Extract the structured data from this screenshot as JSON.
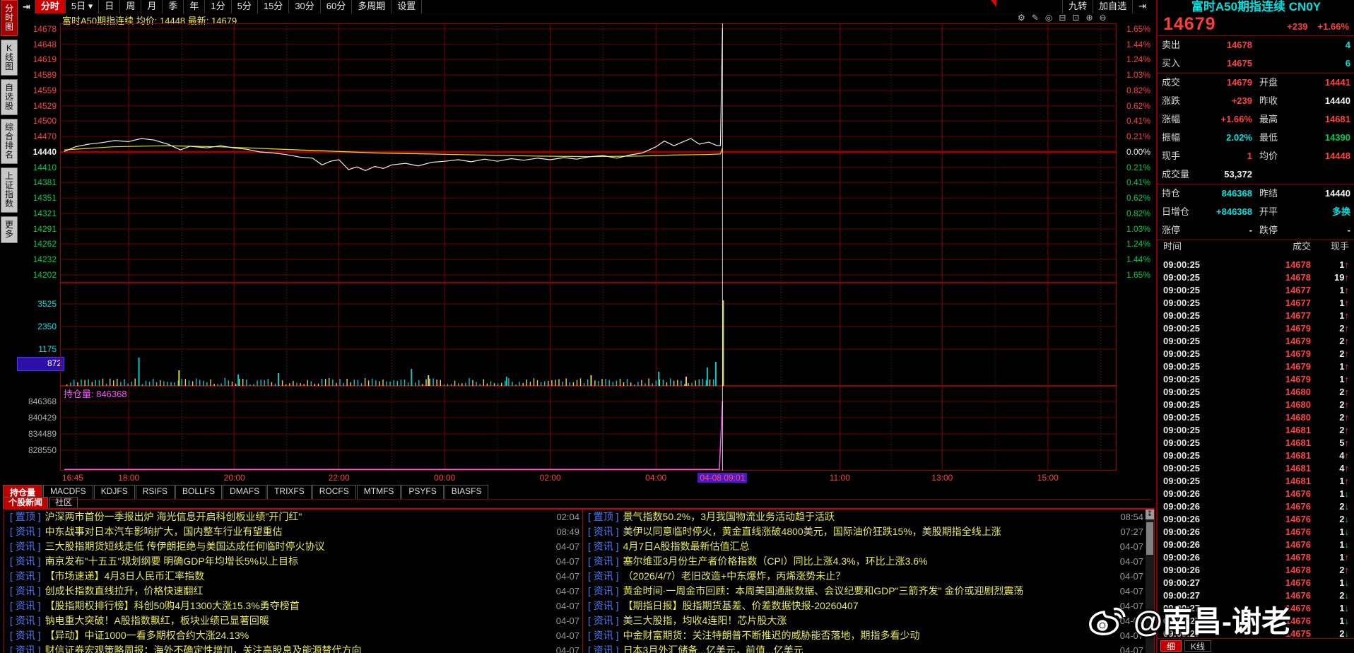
{
  "toolbar": {
    "jump_icon": "⇥",
    "items": [
      {
        "label": "分时",
        "selected": true
      },
      {
        "label": "5日",
        "caret": "▾"
      },
      {
        "label": "日"
      },
      {
        "label": "周"
      },
      {
        "label": "月"
      },
      {
        "label": "季"
      },
      {
        "label": "年"
      },
      {
        "label": "1分"
      },
      {
        "label": "5分"
      },
      {
        "label": "15分"
      },
      {
        "label": "30分"
      },
      {
        "label": "60分"
      },
      {
        "label": "多周期"
      },
      {
        "label": "设置"
      }
    ],
    "right_items": [
      "九转",
      "加自选"
    ],
    "right_jump_icon": "⇥"
  },
  "sidebar": {
    "items": [
      {
        "label": "分时图",
        "selected": true
      },
      {
        "label": "K线图"
      },
      {
        "label": "自选股"
      },
      {
        "label": "综合排名"
      },
      {
        "label": "上证指数"
      },
      {
        "label": "更多"
      }
    ]
  },
  "chart": {
    "header": {
      "name": "富时A50期指连续",
      "avg_label": "均价:",
      "avg": "14448",
      "last_label": "最新:",
      "last": "14679"
    },
    "corner_icons": [
      [
        "gear-icon",
        "⚙"
      ],
      [
        "pencil-icon",
        "✎"
      ],
      [
        "target-icon",
        "◎"
      ],
      [
        "trash-icon",
        "⊟"
      ],
      [
        "lock-icon",
        "⊡"
      ],
      [
        "zoom-in-icon",
        "⊕"
      ],
      [
        "zoom-out-icon",
        "⊖"
      ]
    ],
    "prev_close": 14440,
    "price_axis": [
      14678,
      14648,
      14619,
      14589,
      14559,
      14529,
      14500,
      14470,
      14440,
      14410,
      14381,
      14351,
      14321,
      14291,
      14262,
      14232,
      14202
    ],
    "pct_axis": [
      "1.65%",
      "1.44%",
      "1.24%",
      "1.03%",
      "0.82%",
      "0.62%",
      "0.41%",
      "0.21%",
      "0.00%",
      "0.21%",
      "0.41%",
      "0.62%",
      "0.82%",
      "1.03%",
      "1.24%",
      "1.44%",
      "1.65%"
    ],
    "vol_axis": [
      "3525",
      "2350",
      "1175"
    ],
    "vol_highlight": "872",
    "oi_axis": [
      "846368",
      "840429",
      "834489",
      "828550"
    ],
    "oi_tag": "持仓量: 846368",
    "time_ticks": [
      {
        "label": "16:45",
        "frac": 0.012,
        "major": false
      },
      {
        "label": "18:00",
        "frac": 0.065,
        "major": true
      },
      {
        "label": "20:00",
        "frac": 0.165,
        "major": true
      },
      {
        "label": "22:00",
        "frac": 0.264,
        "major": true
      },
      {
        "label": "00:00",
        "frac": 0.364,
        "major": true
      },
      {
        "label": "02:00",
        "frac": 0.464,
        "major": true
      },
      {
        "label": "04:00",
        "frac": 0.564,
        "major": true
      },
      {
        "label": "04-08 09:01",
        "frac": 0.627,
        "major": false,
        "highlight": true
      },
      {
        "label": "11:00",
        "frac": 0.738,
        "major": true
      },
      {
        "label": "13:00",
        "frac": 0.835,
        "major": true
      },
      {
        "label": "15:00",
        "frac": 0.935,
        "major": true
      }
    ],
    "minor_tick_fracs": [
      0.015,
      0.115,
      0.2145,
      0.314,
      0.414,
      0.514,
      0.6,
      0.6825,
      0.7865,
      0.885,
      0.985
    ],
    "series": {
      "price": [
        [
          0.004,
          14441
        ],
        [
          0.0145,
          14450
        ],
        [
          0.027,
          14455
        ],
        [
          0.0395,
          14458
        ],
        [
          0.052,
          14462
        ],
        [
          0.0645,
          14460
        ],
        [
          0.077,
          14466
        ],
        [
          0.089,
          14463
        ],
        [
          0.102,
          14455
        ],
        [
          0.114,
          14444
        ],
        [
          0.123,
          14451
        ],
        [
          0.139,
          14448
        ],
        [
          0.152,
          14452
        ],
        [
          0.164,
          14448
        ],
        [
          0.177,
          14445
        ],
        [
          0.189,
          14440
        ],
        [
          0.202,
          14438
        ],
        [
          0.214,
          14435
        ],
        [
          0.227,
          14430
        ],
        [
          0.239,
          14428
        ],
        [
          0.248,
          14415
        ],
        [
          0.256,
          14422
        ],
        [
          0.264,
          14425
        ],
        [
          0.273,
          14406
        ],
        [
          0.281,
          14411
        ],
        [
          0.289,
          14404
        ],
        [
          0.298,
          14412
        ],
        [
          0.306,
          14408
        ],
        [
          0.314,
          14415
        ],
        [
          0.327,
          14418
        ],
        [
          0.339,
          14413
        ],
        [
          0.352,
          14420
        ],
        [
          0.364,
          14422
        ],
        [
          0.377,
          14425
        ],
        [
          0.389,
          14421
        ],
        [
          0.402,
          14426
        ],
        [
          0.414,
          14422
        ],
        [
          0.427,
          14427
        ],
        [
          0.439,
          14424
        ],
        [
          0.452,
          14428
        ],
        [
          0.464,
          14425
        ],
        [
          0.477,
          14429
        ],
        [
          0.489,
          14426
        ],
        [
          0.502,
          14431
        ],
        [
          0.514,
          14433
        ],
        [
          0.527,
          14428
        ],
        [
          0.539,
          14434
        ],
        [
          0.551,
          14438
        ],
        [
          0.564,
          14450
        ],
        [
          0.572,
          14461
        ],
        [
          0.581,
          14452
        ],
        [
          0.589,
          14459
        ],
        [
          0.597,
          14466
        ],
        [
          0.605,
          14455
        ],
        [
          0.614,
          14459
        ],
        [
          0.621,
          14453
        ],
        [
          0.625,
          14452
        ],
        [
          0.627,
          14679
        ]
      ],
      "avg": [
        [
          0.004,
          14444
        ],
        [
          0.05,
          14450
        ],
        [
          0.1,
          14452
        ],
        [
          0.15,
          14450
        ],
        [
          0.2,
          14446
        ],
        [
          0.25,
          14442
        ],
        [
          0.3,
          14438
        ],
        [
          0.35,
          14436
        ],
        [
          0.4,
          14434
        ],
        [
          0.45,
          14432
        ],
        [
          0.5,
          14431
        ],
        [
          0.55,
          14432
        ],
        [
          0.58,
          14434
        ],
        [
          0.61,
          14435
        ],
        [
          0.625,
          14436
        ],
        [
          0.627,
          14448
        ]
      ],
      "oi": [
        [
          0.004,
          821500
        ],
        [
          0.624,
          821500
        ],
        [
          0.627,
          846368
        ]
      ],
      "vol_spikes": [
        [
          0.074,
          40,
          "c"
        ],
        [
          0.112,
          22,
          "y"
        ],
        [
          0.168,
          16,
          "c"
        ],
        [
          0.206,
          18,
          "c"
        ],
        [
          0.332,
          24,
          "c"
        ],
        [
          0.348,
          15,
          "y"
        ],
        [
          0.422,
          13,
          "c"
        ],
        [
          0.502,
          15,
          "y"
        ],
        [
          0.566,
          20,
          "c"
        ],
        [
          0.592,
          13,
          "y"
        ],
        [
          0.612,
          26,
          "c"
        ],
        [
          0.62,
          34,
          "c"
        ],
        [
          0.627,
          121,
          "y"
        ]
      ],
      "cursor_frac": 0.627
    }
  },
  "indicator_tabs": {
    "items": [
      "持仓量",
      "MACDFS",
      "KDJFS",
      "RSIFS",
      "BOLLFS",
      "DMAFS",
      "TRIXFS",
      "ROCFS",
      "MTMFS",
      "PSYFS",
      "BIASFS"
    ],
    "selected": "持仓量"
  },
  "news_tabs": {
    "items": [
      "个股新闻",
      "社区"
    ],
    "selected": "个股新闻"
  },
  "news": {
    "download_icon": "↧",
    "left": [
      [
        "置顶",
        "沪深两市首份一季报出炉 海光信息开启科创板业绩\"开门红\"",
        "02:04"
      ],
      [
        "资讯",
        "中东战事对日本汽车影响扩大，国内整车行业有望重估",
        "08:49"
      ],
      [
        "资讯",
        "三大股指期货短线走低 传伊朗拒绝与美国达成任何临时停火协议",
        "04-07"
      ],
      [
        "资讯",
        "南京发布\"十五五\"规划纲要 明确GDP年均增长5%以上目标",
        "04-07"
      ],
      [
        "资讯",
        "【市场速递】4月3日人民币汇率指数",
        "04-07"
      ],
      [
        "资讯",
        "创成长指数直线拉升，价格快速翻红",
        "04-07"
      ],
      [
        "资讯",
        "【股指期权排行榜】科创50购4月1300大涨15.3%勇夺榜首",
        "04-07"
      ],
      [
        "资讯",
        "钠电重大突破！A股指数飘红，板块业绩已显著回暖",
        "04-07"
      ],
      [
        "资讯",
        "【异动】中证1000一看多期权合约大涨24.13%",
        "04-07"
      ],
      [
        "资讯",
        "财信证券宏观策略周报：海外不确定性增加，关注高股息及能源替代方向",
        "04-07"
      ]
    ],
    "right": [
      [
        "置顶",
        "景气指数50.2%，3月我国物流业务活动趋于活跃",
        "08:54"
      ],
      [
        "资讯",
        "美伊以同意临时停火，黄金直线涨破4800美元，国际油价狂跌15%，美股期指全线上涨",
        "07:27"
      ],
      [
        "资讯",
        "4月7日A股指数最新估值汇总",
        "04-07"
      ],
      [
        "资讯",
        "塞尔维亚3月份生产者价格指数（CPI）同比上涨4.3%，环比上涨3.6%",
        "04-07"
      ],
      [
        "资讯",
        "（2026/4/7）老旧改造+中东爆炸，丙烯涨势未止？",
        "04-07"
      ],
      [
        "资讯",
        "黄金时间·一周金市回顾：本周美国通胀数据、会议纪要和GDP\"三箭齐发\" 金价或迎剧烈震荡",
        "04-07"
      ],
      [
        "资讯",
        "【期指日报】股指期货基差、价差数据快报-20260407",
        "04-07"
      ],
      [
        "资讯",
        "美三大股指，均收4连阳！芯片股大涨",
        "04-07"
      ],
      [
        "资讯",
        "中金财富期货：关注特朗普不断推迟的威胁能否落地，期指多看少动",
        "04-07"
      ],
      [
        "资讯",
        "日本3月外汇储备...亿美元，前值...亿美元",
        "04-07"
      ]
    ]
  },
  "quote": {
    "name": "富时A50期指连续 CN0Y",
    "price": "14679",
    "change": "+239",
    "change_pct": "+1.66%",
    "rows": [
      [
        "卖出",
        "14678",
        "red",
        "",
        "4",
        "cyan",
        false
      ],
      [
        "买入",
        "14675",
        "red",
        "",
        "6",
        "cyan",
        true
      ],
      [
        "成交",
        "14679",
        "red",
        "开盘",
        "14441",
        "red",
        false
      ],
      [
        "涨跌",
        "+239",
        "red",
        "昨收",
        "14440",
        "white",
        false
      ],
      [
        "涨幅",
        "+1.66%",
        "red",
        "最高",
        "14681",
        "red",
        false
      ],
      [
        "振幅",
        "2.02%",
        "cyan",
        "最低",
        "14390",
        "green",
        false
      ],
      [
        "现手",
        "1",
        "red",
        "均价",
        "14448",
        "red",
        false
      ],
      [
        "成交量",
        "53,372",
        "white",
        "",
        "",
        "white",
        true
      ],
      [
        "持仓",
        "846368",
        "cyan",
        "昨结",
        "14440",
        "white",
        false
      ],
      [
        "日增仓",
        "+846368",
        "cyan",
        "开平",
        "多换",
        "cyan",
        false
      ],
      [
        "涨停",
        "-",
        "white",
        "跌停",
        "-",
        "white",
        true
      ]
    ]
  },
  "tape": {
    "headers": [
      "时间",
      "成交",
      "现手"
    ],
    "up_arrow": "↑",
    "down_arrow": "↓",
    "rows": [
      [
        "09:00:25",
        "14678",
        "1",
        "u"
      ],
      [
        "09:00:25",
        "14678",
        "19",
        "u"
      ],
      [
        "09:00:25",
        "14677",
        "1",
        "u"
      ],
      [
        "09:00:25",
        "14677",
        "1",
        "u"
      ],
      [
        "09:00:25",
        "14677",
        "1",
        "u"
      ],
      [
        "09:00:25",
        "14679",
        "2",
        "u"
      ],
      [
        "09:00:25",
        "14679",
        "2",
        "u"
      ],
      [
        "09:00:25",
        "14679",
        "2",
        "u"
      ],
      [
        "09:00:25",
        "14679",
        "1",
        "u"
      ],
      [
        "09:00:25",
        "14679",
        "1",
        "u"
      ],
      [
        "09:00:25",
        "14680",
        "2",
        "u"
      ],
      [
        "09:00:25",
        "14680",
        "2",
        "u"
      ],
      [
        "09:00:25",
        "14680",
        "2",
        "u"
      ],
      [
        "09:00:25",
        "14681",
        "2",
        "u"
      ],
      [
        "09:00:25",
        "14681",
        "5",
        "u"
      ],
      [
        "09:00:25",
        "14681",
        "4",
        "u"
      ],
      [
        "09:00:25",
        "14681",
        "4",
        "u"
      ],
      [
        "09:00:25",
        "14681",
        "1",
        "u"
      ],
      [
        "09:00:26",
        "14676",
        "1",
        "d"
      ],
      [
        "09:00:26",
        "14676",
        "2",
        "d"
      ],
      [
        "09:00:26",
        "14676",
        "2",
        "d"
      ],
      [
        "09:00:26",
        "14676",
        "1",
        "d"
      ],
      [
        "09:00:26",
        "14676",
        "1",
        "d"
      ],
      [
        "09:00:26",
        "14678",
        "1",
        "u"
      ],
      [
        "09:00:26",
        "14678",
        "2",
        "u"
      ],
      [
        "09:00:27",
        "14676",
        "1",
        "d"
      ],
      [
        "09:00:27",
        "14676",
        "2",
        "d"
      ],
      [
        "09:00:27",
        "14676",
        "1",
        "d"
      ],
      [
        "09:00:27",
        "14676",
        "1",
        "d"
      ],
      [
        "09:00:27",
        "14675",
        "2",
        "d"
      ]
    ]
  },
  "bottom_tabs": {
    "items": [
      "细",
      "K线"
    ],
    "selected": "细"
  },
  "watermark": {
    "text": "@南昌-谢老"
  },
  "colors": {
    "up": "#ff4040",
    "down": "#00cc44",
    "flat": "#eeeeee",
    "accent_cyan": "#00e0e0",
    "grid": "#6b0000",
    "grid_major": "#7d0000",
    "bright_line": "#c40000",
    "price_line": "#f0f0f0",
    "avg_line": "#e6e600",
    "oi_line": "#ff50ff",
    "vol_cyan": "#00cccc",
    "vol_yellow": "#d8d855",
    "highlight_purple": "#4d16cc"
  }
}
